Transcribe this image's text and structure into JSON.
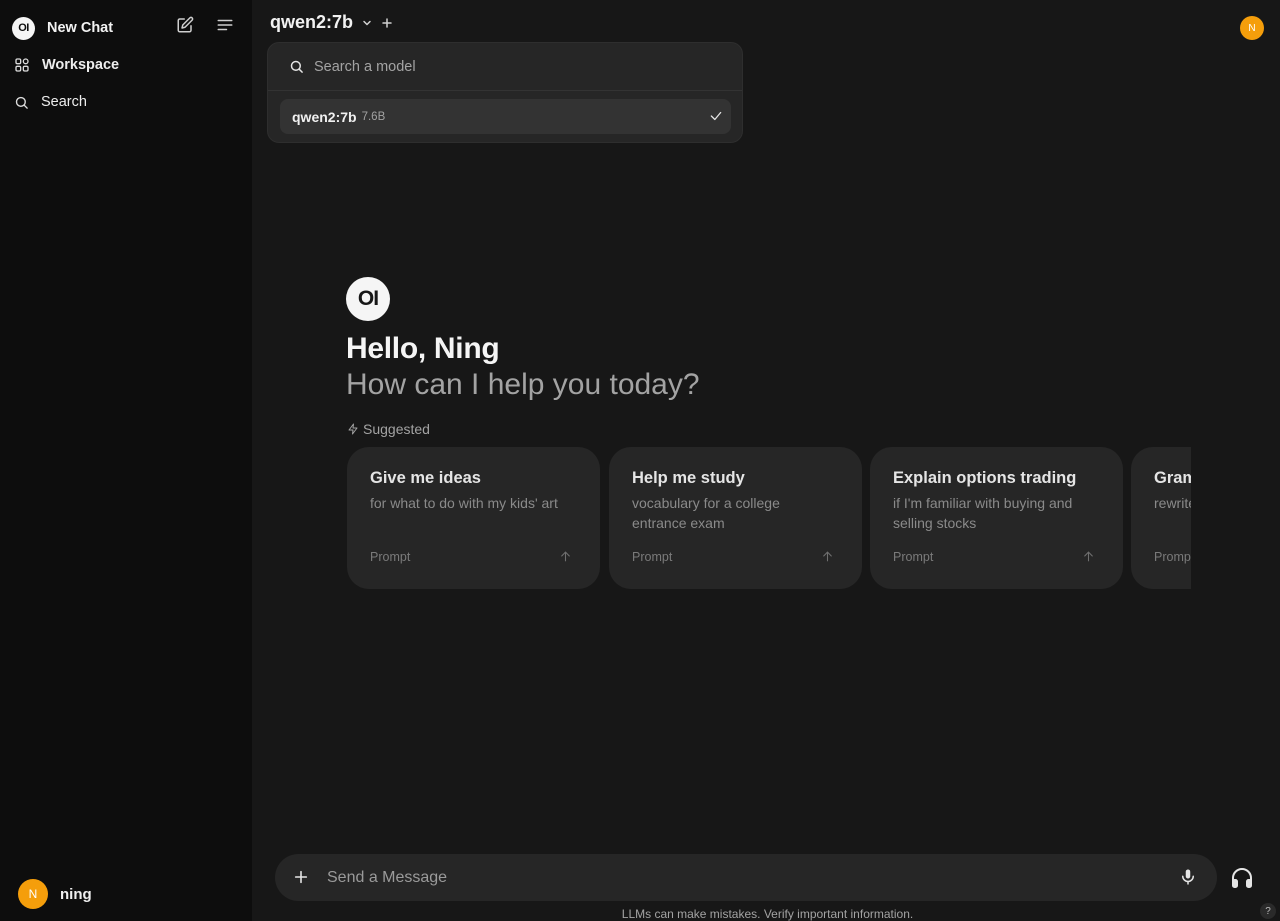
{
  "sidebar": {
    "logo_text": "OI",
    "title": "New Chat",
    "items": [
      {
        "label": "Workspace",
        "icon": "workspace-icon"
      },
      {
        "label": "Search",
        "icon": "search-icon"
      }
    ],
    "user": {
      "initial": "N",
      "name": "ning"
    }
  },
  "header": {
    "model": "qwen2:7b",
    "avatar_initial": "N"
  },
  "model_dropdown": {
    "search_placeholder": "Search a model",
    "items": [
      {
        "name": "qwen2:7b",
        "size": "7.6B",
        "selected": true
      }
    ]
  },
  "hero": {
    "logo_text": "OI",
    "greeting": "Hello, Ning",
    "subtitle": "How can I help you today?",
    "suggested_label": "Suggested"
  },
  "suggestions": [
    {
      "title": "Give me ideas",
      "subtitle": "for what to do with my kids' art",
      "tag": "Prompt"
    },
    {
      "title": "Help me study",
      "subtitle": "vocabulary for a college entrance exam",
      "tag": "Prompt"
    },
    {
      "title": "Explain options trading",
      "subtitle": "if I'm familiar with buying and selling stocks",
      "tag": "Prompt"
    },
    {
      "title": "Grammar check",
      "subtitle": "rewrite it for better readability",
      "tag": "Prompt"
    }
  ],
  "composer": {
    "placeholder": "Send a Message"
  },
  "footer": {
    "disclaimer": "LLMs can make mistakes. Verify important information.",
    "help": "?"
  },
  "colors": {
    "sidebar_bg": "#0d0d0d",
    "main_bg": "#171717",
    "card_bg": "#262626",
    "avatar": "#f59e0b"
  }
}
